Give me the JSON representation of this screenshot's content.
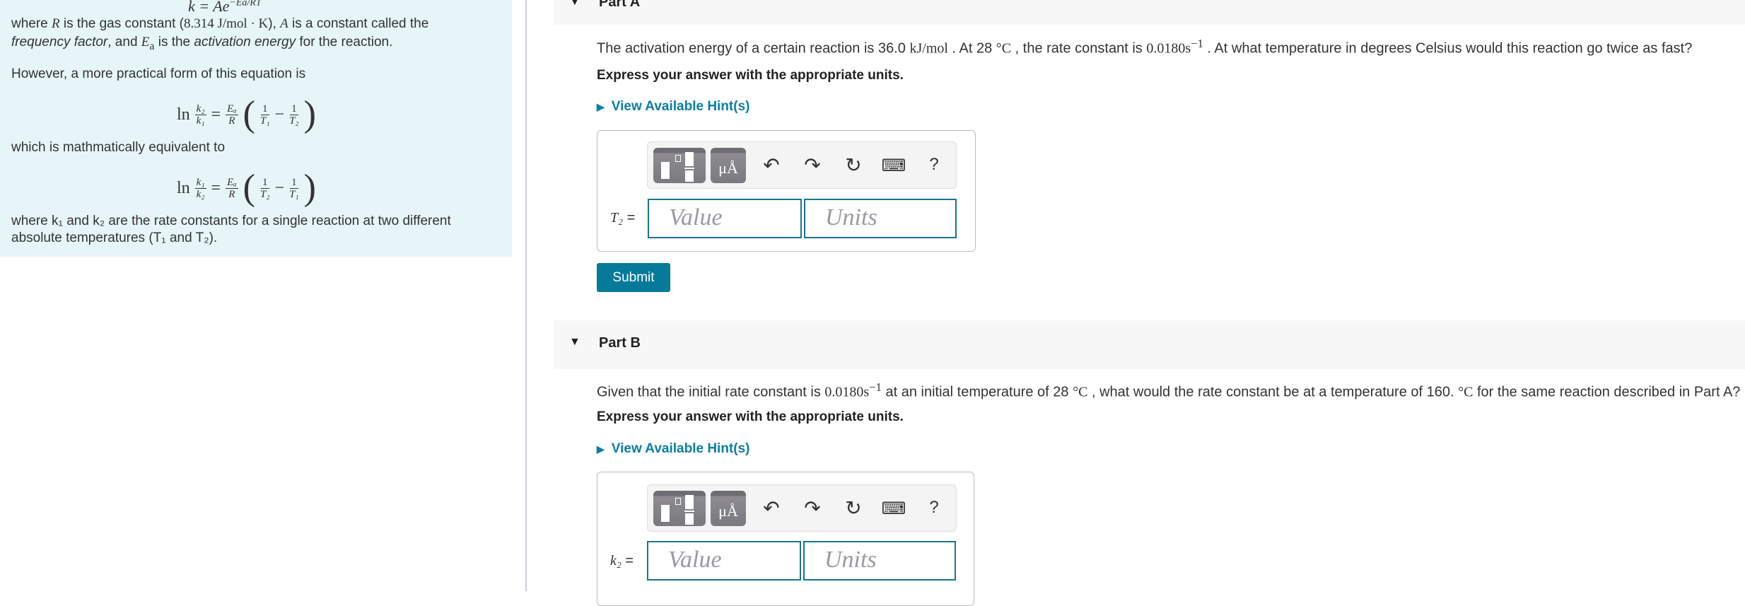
{
  "intro": {
    "formula_k": "k = Ae",
    "formula_exp": "−Ea/RT",
    "line1_a": "where ",
    "line1_R": "R",
    "line1_b": " is the gas constant (",
    "line1_const": "8.314 J/mol · K",
    "line1_c": "), ",
    "line1_A": "A",
    "line1_d": " is a constant called the",
    "line2_a": "frequency factor",
    "line2_b": ", and ",
    "line2_E": "E",
    "line2_sub": "a",
    "line2_c": " is the ",
    "line2_d": "activation energy",
    "line2_e": " for the reaction.",
    "practical": "However, a more practical form of this equation is",
    "equivalent": "which is mathmatically equivalent to",
    "line3": "where k₁ and k₂ are the rate constants for a single reaction at two different",
    "line4": "absolute temperatures (T₁ and T₂)."
  },
  "eq1": {
    "ln": "ln",
    "num": "k₂",
    "den": "k₁",
    "ea": "Eₐ",
    "r": "R",
    "one": "1",
    "t_a": "T₁",
    "t_b": "T₂"
  },
  "eq2": {
    "ln": "ln",
    "num": "k₁",
    "den": "k₂",
    "ea": "Eₐ",
    "r": "R",
    "one": "1",
    "t_a": "T₂",
    "t_b": "T₁"
  },
  "part_a": {
    "title": "Part A",
    "question_a": "The activation energy of a certain reaction is 36.0 ",
    "u1": "kJ/mol",
    "question_b": " . At 28 ",
    "u2": "°C",
    "question_c": " , the rate constant is ",
    "u3": "0.0180s",
    "sup": "−1",
    "question_d": " . At what temperature in degrees Celsius would this reaction go twice as fast?",
    "express": "Express your answer with the appropriate units.",
    "hint": "View Available Hint(s)",
    "label": "T₂",
    "eq": " =",
    "value_placeholder": "Value",
    "units_placeholder": "Units",
    "submit": "Submit"
  },
  "part_b": {
    "title": "Part B",
    "question_a": "Given that the initial rate constant is ",
    "u1": "0.0180s",
    "sup": "−1",
    "question_b": " at an initial temperature of 28 ",
    "u2": "°C",
    "question_c": " , what would the rate constant be at a temperature of 160. ",
    "u3": "°C",
    "question_d": " for the same reaction described in Part A?",
    "express": "Express your answer with the appropriate units.",
    "hint": "View Available Hint(s)",
    "label": "k₂",
    "eq": " =",
    "value_placeholder": "Value",
    "units_placeholder": "Units"
  },
  "toolbar": {
    "units_label": "μÅ",
    "help": "?",
    "icons": [
      "templates-icon",
      "units-icon",
      "undo-icon",
      "redo-icon",
      "reset-icon",
      "keyboard-icon",
      "help-icon"
    ]
  },
  "colors": {
    "accent": "#067a99",
    "panel": "#e6f5f7",
    "input_border": "#1a7393"
  }
}
